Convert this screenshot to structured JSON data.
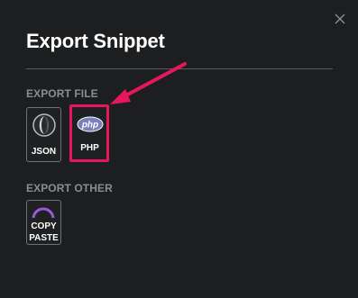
{
  "dialog": {
    "title": "Export Snippet",
    "close_icon": "close-x-icon"
  },
  "export_file": {
    "label": "EXPORT FILE",
    "items": [
      {
        "label": "JSON",
        "icon": "json-icon"
      },
      {
        "label": "PHP",
        "icon": "php-icon",
        "icon_text": "php"
      }
    ]
  },
  "export_other": {
    "label": "EXPORT OTHER",
    "items": [
      {
        "label_line1": "COPY",
        "label_line2": "PASTE",
        "icon": "copy-paste-icon"
      }
    ]
  },
  "colors": {
    "background": "#1d1e20",
    "highlight": "#e8175d",
    "copy_icon": "#9a5ad8",
    "php_logo": "#7a7fbd"
  }
}
